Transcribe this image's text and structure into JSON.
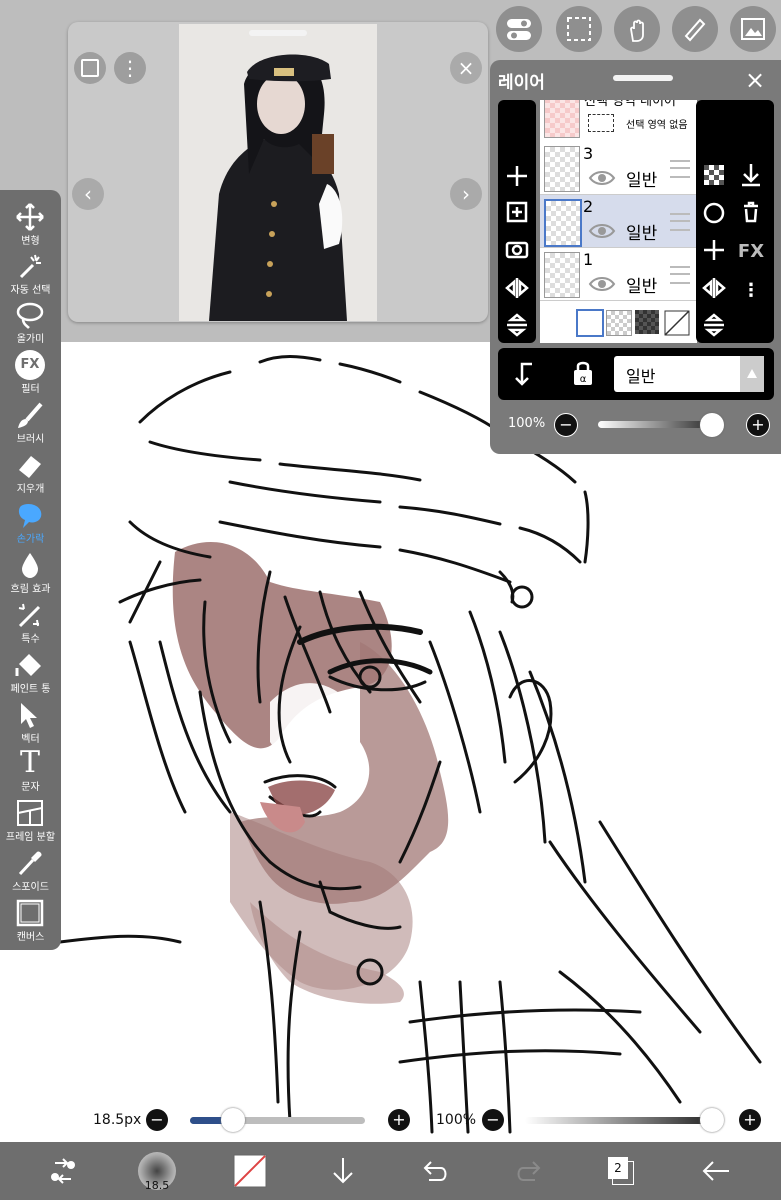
{
  "layers_panel": {
    "title": "레이어",
    "close_label": "×",
    "selection_layer": {
      "label": "선택 영역 레이어",
      "sub": "선택 영역 없음"
    },
    "layers": [
      {
        "number": "3",
        "mode": "일반"
      },
      {
        "number": "2",
        "mode": "일반",
        "selected": true
      },
      {
        "number": "1",
        "mode": "일반"
      }
    ],
    "blend_mode": "일반",
    "opacity": "100%",
    "opacity_value": 1.0,
    "fx_label": "FX"
  },
  "left_toolbar": {
    "tools": [
      {
        "label": "변형",
        "icon": "move-icon"
      },
      {
        "label": "자동 선택",
        "icon": "magic-wand-icon"
      },
      {
        "label": "올가미",
        "icon": "lasso-icon"
      },
      {
        "label": "필터",
        "icon": "fx-icon",
        "glyph": "FX"
      },
      {
        "label": "브러시",
        "icon": "brush-icon"
      },
      {
        "label": "지우개",
        "icon": "eraser-icon"
      },
      {
        "label": "손가락",
        "icon": "finger-icon",
        "active": true
      },
      {
        "label": "흐림 효과",
        "icon": "blur-drop-icon"
      },
      {
        "label": "특수",
        "icon": "special-icon"
      },
      {
        "label": "페인트 통",
        "icon": "paint-bucket-icon"
      },
      {
        "label": "벡터",
        "icon": "vector-arrow-icon"
      },
      {
        "label": "문자",
        "icon": "text-icon",
        "glyph": "T"
      },
      {
        "label": "프레임 분할",
        "icon": "frame-divider-icon"
      },
      {
        "label": "스포이드",
        "icon": "eyedropper-icon"
      },
      {
        "label": "캔버스",
        "icon": "canvas-icon"
      }
    ]
  },
  "brush_size": {
    "label": "18.5px",
    "value": 18.5
  },
  "brush_opacity": {
    "label": "100%",
    "value": 1.0
  },
  "bottom_bar": {
    "brush_preview_label": "18.5",
    "layers_count": "2"
  },
  "colors": {
    "accent": "#4aa8ff",
    "slider_fill": "#2e4f8a",
    "skin_shade": "#9a6a68"
  }
}
